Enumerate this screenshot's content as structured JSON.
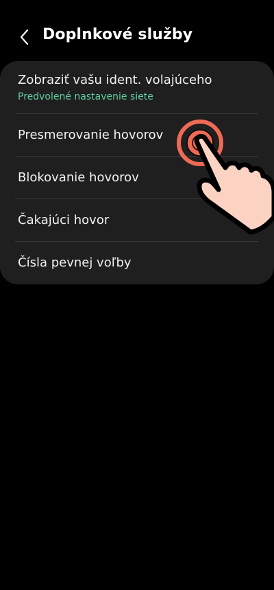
{
  "header": {
    "back_icon": "chevron-left-icon",
    "title": "Doplnkové služby"
  },
  "settings": {
    "items": [
      {
        "label": "Zobraziť vašu ident. volajúceho",
        "sub": "Predvolené nastavenie siete"
      },
      {
        "label": "Presmerovanie hovorov"
      },
      {
        "label": "Blokovanie hovorov"
      },
      {
        "label": "Čakajúci hovor"
      },
      {
        "label": "Čísla pevnej voľby"
      }
    ]
  },
  "overlay": {
    "icon": "tap-hand-icon",
    "ring_color": "#ef6a55",
    "hand_color": "#fcd3c3"
  },
  "colors": {
    "background": "#000000",
    "card": "#1f1f1f",
    "subtitle_accent": "#5fd0a0"
  }
}
